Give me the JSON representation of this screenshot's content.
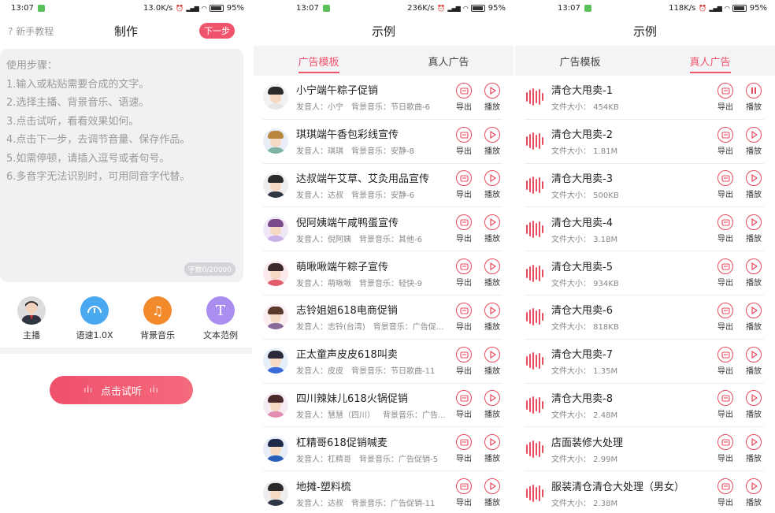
{
  "colors": {
    "accent": "#f0546c",
    "bar_bg": "#f4f4f6"
  },
  "screen1": {
    "status": {
      "time": "13:07",
      "speed": "13.0K/s",
      "battery": "95"
    },
    "nav": {
      "left": "新手教程",
      "title": "制作",
      "next": "下一步"
    },
    "steps": [
      "使用步骤：",
      "1.输入或粘贴需要合成的文字。",
      "2.选择主播、背景音乐、语速。",
      "3.点击试听，看看效果如何。",
      "4.点击下一步，去调节音量、保存作品。",
      "5.如需停顿，请插入逗号或者句号。",
      "6.多音字无法识别时，可用同音字代替。"
    ],
    "char_count": "字数0/20000",
    "tools": [
      {
        "label": "主播",
        "icon": "anchor-avatar-icon"
      },
      {
        "label": "语速1.0X",
        "icon": "speed-gauge-icon"
      },
      {
        "label": "背景音乐",
        "icon": "music-note-icon"
      },
      {
        "label": "文本范例",
        "icon": "text-t-icon"
      }
    ],
    "listen": "点击试听"
  },
  "screen2": {
    "status": {
      "time": "13:07",
      "speed": "236K/s",
      "battery": "95"
    },
    "nav": {
      "title": "示例"
    },
    "tabs": [
      "广告模板",
      "真人广告"
    ],
    "items": [
      {
        "title": "小宁端午粽子促销",
        "speaker": "发音人：小宁",
        "music": "背景音乐：节日歌曲-6"
      },
      {
        "title": "琪琪端午香包彩线宣传",
        "speaker": "发音人：琪琪",
        "music": "背景音乐：安静-8"
      },
      {
        "title": "达叔端午艾草、艾灸用品宣传",
        "speaker": "发音人：达叔",
        "music": "背景音乐：安静-6"
      },
      {
        "title": "倪阿姨端午咸鸭蛋宣传",
        "speaker": "发音人：倪阿姨",
        "music": "背景音乐：其他-6"
      },
      {
        "title": "萌啾啾端午粽子宣传",
        "speaker": "发音人：萌啾啾",
        "music": "背景音乐：轻快-9"
      },
      {
        "title": "志铃姐姐618电商促销",
        "speaker": "发音人：志铃(台湾)",
        "music": "背景音乐：广告促..."
      },
      {
        "title": "正太童声皮皮618叫卖",
        "speaker": "发音人：皮皮",
        "music": "背景音乐：节日歌曲-11"
      },
      {
        "title": "四川辣妹儿618火锅促销",
        "speaker": "发音人：慧慧（四川）",
        "music": "背景音乐：广告..."
      },
      {
        "title": "杠精哥618促销喊麦",
        "speaker": "发音人：杠精哥",
        "music": "背景音乐：广告促销-5"
      },
      {
        "title": "地摊-塑料梳",
        "speaker": "发音人：达叔",
        "music": "背景音乐：广告促销-11"
      }
    ],
    "export_label": "导出",
    "play_label": "播放"
  },
  "screen3": {
    "status": {
      "time": "13:07",
      "speed": "118K/s",
      "battery": "95"
    },
    "nav": {
      "title": "示例"
    },
    "tabs": [
      "广告模板",
      "真人广告"
    ],
    "items": [
      {
        "title": "清仓大甩卖-1",
        "size": "文件大小：  454KB",
        "state": "pause"
      },
      {
        "title": "清仓大甩卖-2",
        "size": "文件大小：  1.81M",
        "state": "play"
      },
      {
        "title": "清仓大甩卖-3",
        "size": "文件大小：  500KB",
        "state": "play"
      },
      {
        "title": "清仓大甩卖-4",
        "size": "文件大小：  3.18M",
        "state": "play"
      },
      {
        "title": "清仓大甩卖-5",
        "size": "文件大小：  934KB",
        "state": "play"
      },
      {
        "title": "清仓大甩卖-6",
        "size": "文件大小：  818KB",
        "state": "play"
      },
      {
        "title": "清仓大甩卖-7",
        "size": "文件大小：  1.35M",
        "state": "play"
      },
      {
        "title": "清仓大甩卖-8",
        "size": "文件大小：  2.48M",
        "state": "play"
      },
      {
        "title": "店面装修大处理",
        "size": "文件大小：  2.99M",
        "state": "play"
      },
      {
        "title": "服装清仓清仓大处理（男女）",
        "size": "文件大小：  2.38M",
        "state": "play"
      }
    ],
    "export_label": "导出",
    "play_label": "播放"
  }
}
